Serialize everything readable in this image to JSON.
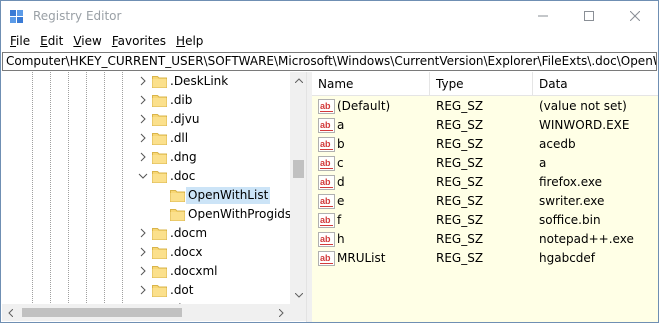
{
  "window": {
    "title": "Registry Editor"
  },
  "menu": [
    {
      "mnemonic": "F",
      "rest": "ile"
    },
    {
      "mnemonic": "E",
      "rest": "dit"
    },
    {
      "mnemonic": "V",
      "rest": "iew"
    },
    {
      "mnemonic": "F",
      "rest": "avorites"
    },
    {
      "mnemonic": "H",
      "rest": "elp"
    }
  ],
  "address": {
    "path": "Computer\\HKEY_CURRENT_USER\\SOFTWARE\\Microsoft\\Windows\\CurrentVersion\\Explorer\\FileExts\\.doc\\OpenWithList"
  },
  "tree": {
    "items": [
      {
        "label": ".DeskLink",
        "expander": "collapsed"
      },
      {
        "label": ".dib",
        "expander": "collapsed"
      },
      {
        "label": ".djvu",
        "expander": "collapsed"
      },
      {
        "label": ".dll",
        "expander": "collapsed"
      },
      {
        "label": ".dng",
        "expander": "collapsed"
      },
      {
        "label": ".doc",
        "expander": "expanded"
      },
      {
        "label": "OpenWithList",
        "expander": "none",
        "selected": true,
        "child": true
      },
      {
        "label": "OpenWithProgids",
        "expander": "none",
        "child": true
      },
      {
        "label": ".docm",
        "expander": "collapsed"
      },
      {
        "label": ".docx",
        "expander": "collapsed"
      },
      {
        "label": ".docxml",
        "expander": "collapsed"
      },
      {
        "label": ".dot",
        "expander": "collapsed"
      },
      {
        "label": ".dotm",
        "expander": "collapsed"
      }
    ]
  },
  "values": {
    "columns": {
      "name": "Name",
      "type": "Type",
      "data": "Data"
    },
    "rows": [
      {
        "name": "(Default)",
        "type": "REG_SZ",
        "data": "(value not set)"
      },
      {
        "name": "a",
        "type": "REG_SZ",
        "data": "WINWORD.EXE"
      },
      {
        "name": "b",
        "type": "REG_SZ",
        "data": "acedb"
      },
      {
        "name": "c",
        "type": "REG_SZ",
        "data": "a"
      },
      {
        "name": "d",
        "type": "REG_SZ",
        "data": "firefox.exe"
      },
      {
        "name": "e",
        "type": "REG_SZ",
        "data": "swriter.exe"
      },
      {
        "name": "f",
        "type": "REG_SZ",
        "data": "soffice.bin"
      },
      {
        "name": "h",
        "type": "REG_SZ",
        "data": "notepad++.exe"
      },
      {
        "name": "MRUList",
        "type": "REG_SZ",
        "data": "hgabcdef"
      }
    ]
  },
  "icons": {
    "app": "registry-editor-icon",
    "folder": "folder-icon",
    "value": "string-value-icon"
  },
  "colors": {
    "selection": "#cce4f7",
    "values_bg": "#ffffe6",
    "folder": "#f8d775",
    "value_icon_red": "#d23a3a"
  }
}
